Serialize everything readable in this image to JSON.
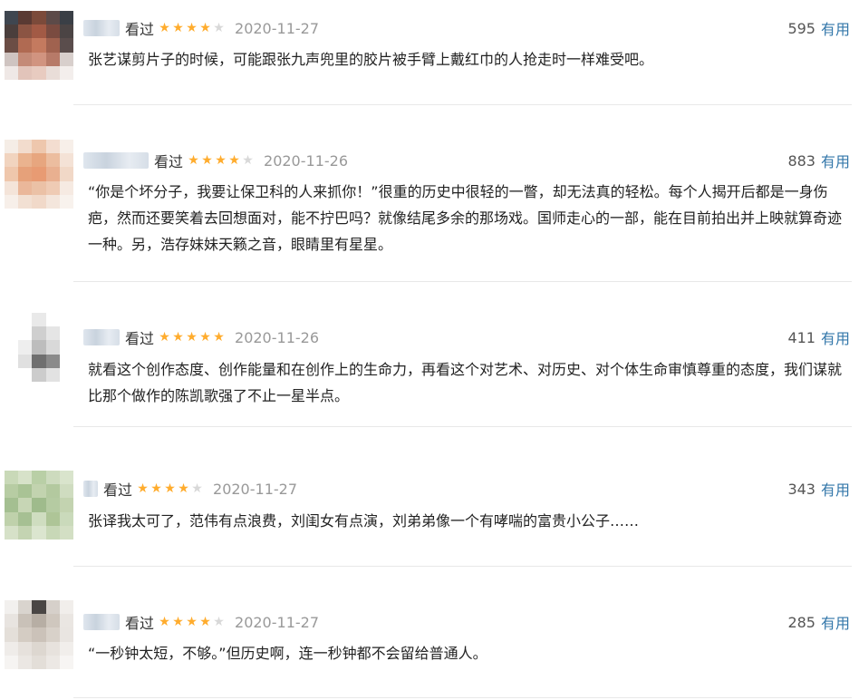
{
  "reviews": [
    {
      "watched_label": "看过",
      "rating_stars": 4,
      "date": "2020-11-27",
      "vote_count": "595",
      "useful_label": "有用",
      "content": "张艺谋剪片子的时候，可能跟张九声兜里的胶片被手臂上戴红巾的人抢走时一样难受吧。",
      "avatar_palette": [
        "#3f4650",
        "#5a3a33",
        "#7b4a3a",
        "#5c4a48",
        "#3a3f46",
        "#4a3e3c",
        "#8b5443",
        "#a25a45",
        "#7a4b40",
        "#4b4444",
        "#6b4d45",
        "#b06a52",
        "#c47a5f",
        "#a0624f",
        "#5a4d4c",
        "#cfc4c1",
        "#c48a77",
        "#d19480",
        "#b77a68",
        "#d8cfcc",
        "#efe8e6",
        "#e2c4ba",
        "#e8cbc0",
        "#e9ddd8",
        "#f3eeec"
      ]
    },
    {
      "watched_label": "看过",
      "rating_stars": 4,
      "date": "2020-11-26",
      "vote_count": "883",
      "useful_label": "有用",
      "content": "“你是个坏分子，我要让保卫科的人来抓你！”很重的历史中很轻的一瞥，却无法真的轻松。每个人揭开后都是一身伤疤，然而还要笑着去回想面对，能不拧巴吗？就像结尾多余的那场戏。国师走心的一部，能在目前拍出并上映就算奇迹一种。另，浩存妹妹天籁之音，眼睛里有星星。",
      "avatar_palette": [
        "#f5ede6",
        "#f2dccd",
        "#eec7ad",
        "#f3ddd0",
        "#f7efe9",
        "#f1d4bf",
        "#eab38f",
        "#e7a67f",
        "#ecbd9f",
        "#f4e2d6",
        "#efc7ac",
        "#e6a17a",
        "#e89b73",
        "#e9b090",
        "#f1d8c7",
        "#f4e4d9",
        "#eab79a",
        "#ebc1a6",
        "#efcbb4",
        "#f6eae2",
        "#f7efe9",
        "#f2e0d3",
        "#f1d9c9",
        "#f4e6dc",
        "#f8f2ed"
      ]
    },
    {
      "watched_label": "看过",
      "rating_stars": 5,
      "date": "2020-11-26",
      "vote_count": "411",
      "useful_label": "有用",
      "content": "就看这个创作态度、创作能量和在创作上的生命力，再看这个对艺术、对历史、对个体生命审慎尊重的态度，我们谋就比那个做作的陈凯歌强了不止一星半点。",
      "avatar_palette": [
        "#ffffff",
        "#ffffff",
        "#e9e9e9",
        "#ffffff",
        "#ffffff",
        "#ffffff",
        "#ffffff",
        "#cfcfcf",
        "#e5e5e5",
        "#ffffff",
        "#ffffff",
        "#eeeeee",
        "#bdbdbd",
        "#d9d9d9",
        "#ffffff",
        "#ffffff",
        "#e0e0e0",
        "#6f6f6f",
        "#8a8a8a",
        "#ffffff",
        "#ffffff",
        "#ffffff",
        "#cccccc",
        "#e2e2e2",
        "#ffffff"
      ]
    },
    {
      "watched_label": "看过",
      "rating_stars": 4,
      "date": "2020-11-27",
      "vote_count": "343",
      "useful_label": "有用",
      "content": "张译我太可了，范伟有点浪费，刘闺女有点演，刘弟弟像一个有哮喘的富贵小公子……",
      "avatar_palette": [
        "#c9d9b8",
        "#d7e2c9",
        "#b9cfa6",
        "#cddbbe",
        "#d9e4cc",
        "#b7cca3",
        "#a9c395",
        "#c2d3af",
        "#b3c99f",
        "#cfdcc0",
        "#a4bf91",
        "#c7d6b5",
        "#9fbb8c",
        "#b5cba2",
        "#c3d3b0",
        "#bfd1ab",
        "#a6c093",
        "#cfddc0",
        "#aec597",
        "#cadabb",
        "#d6e1c8",
        "#c4d4b2",
        "#dbe5cf",
        "#c8d8b7",
        "#d3dfc4"
      ]
    },
    {
      "watched_label": "看过",
      "rating_stars": 4,
      "date": "2020-11-27",
      "vote_count": "285",
      "useful_label": "有用",
      "content": "“一秒钟太短，不够。”但历史啊，连一秒钟都不会留给普通人。",
      "avatar_palette": [
        "#f2f0ee",
        "#d9d4ce",
        "#4a4644",
        "#d6d0ca",
        "#f1eeeb",
        "#e8e4e0",
        "#c9c1b8",
        "#b7aea4",
        "#cfc7be",
        "#eae6e2",
        "#e4dfd9",
        "#d4ccc3",
        "#cbc2b9",
        "#d8d1c9",
        "#e9e5e1",
        "#efece9",
        "#e6e1dc",
        "#ddd7d0",
        "#e7e2dd",
        "#f1eeeb",
        "#f6f4f2",
        "#ebe7e3",
        "#e3ded8",
        "#ece8e4",
        "#f7f5f3"
      ]
    }
  ]
}
